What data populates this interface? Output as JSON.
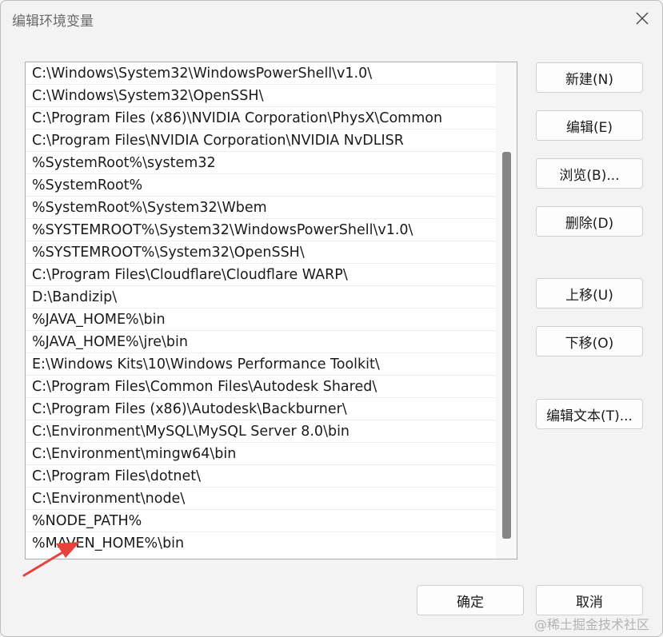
{
  "dialog": {
    "title": "编辑环境变量"
  },
  "paths": [
    "C:\\Windows\\System32\\WindowsPowerShell\\v1.0\\",
    "C:\\Windows\\System32\\OpenSSH\\",
    "C:\\Program Files (x86)\\NVIDIA Corporation\\PhysX\\Common",
    "C:\\Program Files\\NVIDIA Corporation\\NVIDIA NvDLISR",
    "%SystemRoot%\\system32",
    "%SystemRoot%",
    "%SystemRoot%\\System32\\Wbem",
    "%SYSTEMROOT%\\System32\\WindowsPowerShell\\v1.0\\",
    "%SYSTEMROOT%\\System32\\OpenSSH\\",
    "C:\\Program Files\\Cloudflare\\Cloudflare WARP\\",
    "D:\\Bandizip\\",
    "%JAVA_HOME%\\bin",
    "%JAVA_HOME%\\jre\\bin",
    "E:\\Windows Kits\\10\\Windows Performance Toolkit\\",
    "C:\\Program Files\\Common Files\\Autodesk Shared\\",
    "C:\\Program Files (x86)\\Autodesk\\Backburner\\",
    "C:\\Environment\\MySQL\\MySQL Server 8.0\\bin",
    "C:\\Environment\\mingw64\\bin",
    "C:\\Program Files\\dotnet\\",
    "C:\\Environment\\node\\",
    "%NODE_PATH%",
    "%MAVEN_HOME%\\bin"
  ],
  "buttons": {
    "new": "新建(N)",
    "edit": "编辑(E)",
    "browse": "浏览(B)...",
    "delete": "删除(D)",
    "move_up": "上移(U)",
    "move_down": "下移(O)",
    "edit_text": "编辑文本(T)...",
    "ok": "确定",
    "cancel": "取消"
  },
  "icons": {
    "close": "close-icon",
    "annotation": "red-arrow-icon"
  },
  "colors": {
    "annotation_arrow": "#e8403a",
    "scrollbar_thumb": "#858585"
  },
  "watermark": "@稀土掘金技术社区"
}
